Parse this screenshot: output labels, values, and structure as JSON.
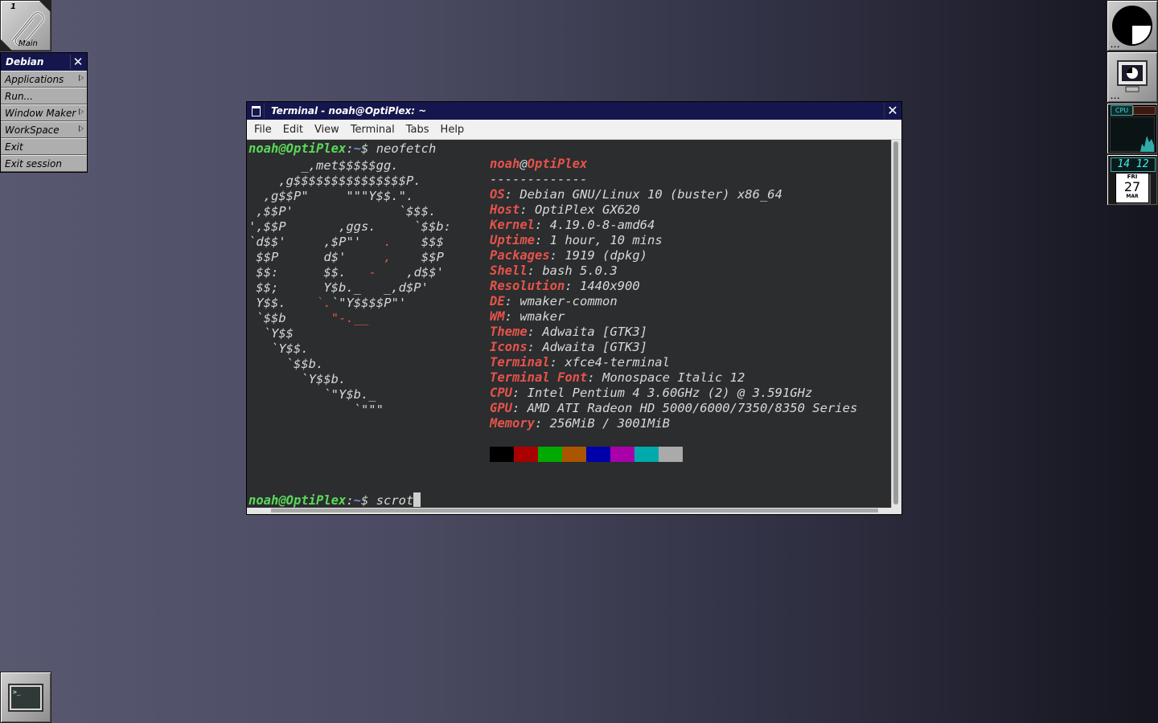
{
  "workspace": {
    "number": "1",
    "name": "Main"
  },
  "root_menu": {
    "title": "Debian",
    "items": [
      {
        "label": "Applications",
        "submenu": true
      },
      {
        "label": "Run...",
        "submenu": false
      },
      {
        "label": "Window Maker",
        "submenu": true
      },
      {
        "label": "WorkSpace",
        "submenu": true
      },
      {
        "label": "Exit",
        "submenu": false
      },
      {
        "label": "Exit session",
        "submenu": false
      }
    ]
  },
  "dock": {
    "clock": {
      "time": "14 12",
      "weekday": "FRI",
      "day": "27",
      "month": "MAR"
    },
    "cpu_label": "CPU",
    "dots": "..."
  },
  "terminal": {
    "title": "Terminal - noah@OptiPlex: ~",
    "menu": [
      "File",
      "Edit",
      "View",
      "Terminal",
      "Tabs",
      "Help"
    ],
    "prompt": {
      "user_host": "noah@OptiPlex",
      "sep": ":",
      "path": "~",
      "symbol": "$ "
    },
    "command1": "neofetch",
    "command2": "scrot",
    "logo_lines": [
      "       _,met$$$$$gg.",
      "    ,g$$$$$$$$$$$$$$$P.",
      "  ,g$$P\"     \"\"\"Y$$.\".",
      " ,$$P'              `$$$.",
      "',$$P       ,ggs.     `$$b:",
      "`d$$'     ,$P\"'   .    $$$",
      " $$P      d$'     ,    $$P",
      " $$:      $$.   -    ,d$$'",
      " $$;      Y$b._   _,d$P'",
      " Y$$.    `.`\"Y$$$$P\"'",
      " `$$b      \"-.__",
      "  `Y$$",
      "   `Y$$.",
      "     `$$b.",
      "       `Y$$b.",
      "          `\"Y$b._",
      "              `\"\"\""
    ],
    "info": {
      "user": "noah",
      "at": "@",
      "host": "OptiPlex",
      "separator": "-------------",
      "rows": [
        {
          "key": "OS",
          "value": "Debian GNU/Linux 10 (buster) x86_64"
        },
        {
          "key": "Host",
          "value": "OptiPlex GX620"
        },
        {
          "key": "Kernel",
          "value": "4.19.0-8-amd64"
        },
        {
          "key": "Uptime",
          "value": "1 hour, 10 mins"
        },
        {
          "key": "Packages",
          "value": "1919 (dpkg)"
        },
        {
          "key": "Shell",
          "value": "bash 5.0.3"
        },
        {
          "key": "Resolution",
          "value": "1440x900"
        },
        {
          "key": "DE",
          "value": "wmaker-common"
        },
        {
          "key": "WM",
          "value": "wmaker"
        },
        {
          "key": "Theme",
          "value": "Adwaita [GTK3]"
        },
        {
          "key": "Icons",
          "value": "Adwaita [GTK3]"
        },
        {
          "key": "Terminal",
          "value": "xfce4-terminal"
        },
        {
          "key": "Terminal Font",
          "value": "Monospace Italic 12"
        },
        {
          "key": "CPU",
          "value": "Intel Pentium 4 3.60GHz (2) @ 3.591GHz"
        },
        {
          "key": "GPU",
          "value": "AMD ATI Radeon HD 5000/6000/7350/8350 Series"
        },
        {
          "key": "Memory",
          "value": "256MiB / 3001MiB"
        }
      ],
      "palette": [
        "#000000",
        "#aa0000",
        "#00aa00",
        "#aa5500",
        "#0000aa",
        "#aa00aa",
        "#00aaaa",
        "#aaaaaa"
      ]
    }
  }
}
